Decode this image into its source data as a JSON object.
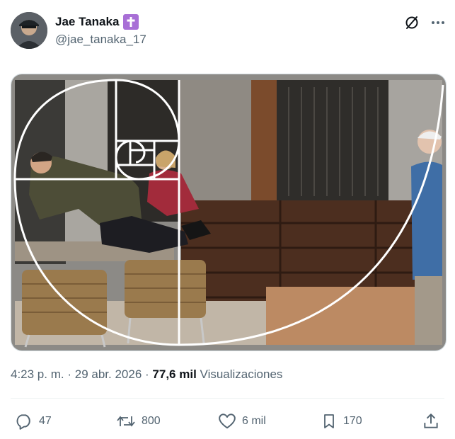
{
  "author": {
    "name": "Jae Tanaka",
    "handle": "@jae_tanaka_17",
    "badge_icon": "latin-cross-icon",
    "badge_color": "#a86fd6"
  },
  "header_actions": {
    "grok_icon": "slashed-circle-icon",
    "more_icon": "more-horizontal-icon"
  },
  "post": {
    "time": "4:23 p. m.",
    "separator": "·",
    "date": "29 abr. 2026",
    "views_count": "77,6 mil",
    "views_label": "Visualizaciones"
  },
  "actions": {
    "replies": "47",
    "reposts": "800",
    "likes": "6 mil",
    "bookmarks": "170"
  },
  "colors": {
    "text_primary": "#0f1419",
    "text_secondary": "#536471",
    "border": "#cfd9de"
  }
}
